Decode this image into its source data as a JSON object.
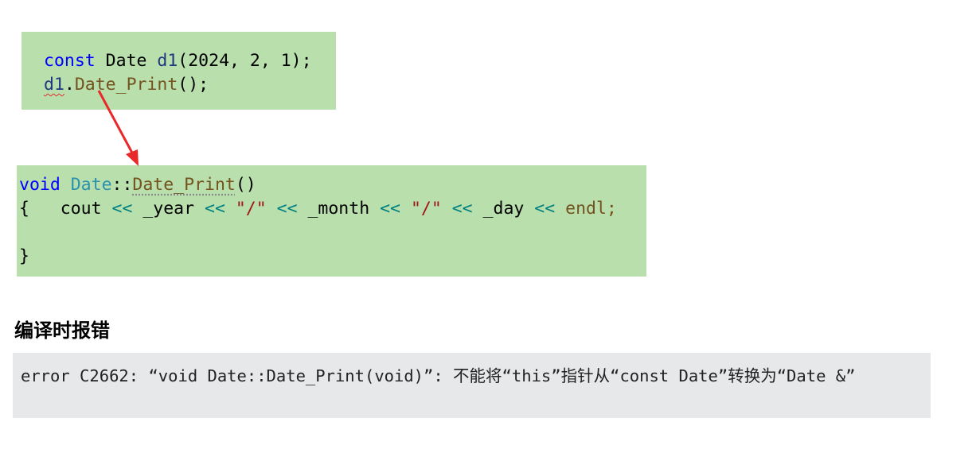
{
  "snippet1": {
    "line1": {
      "kw": "const",
      "type": " Date ",
      "var": "d1",
      "rest": "(2024, 2, 1);"
    },
    "line2": {
      "var": "d1",
      "dot": ".",
      "fn": "Date_Print",
      "rest": "();"
    }
  },
  "snippet2": {
    "sig": {
      "kw": "void",
      "cls": "Date",
      "sep": "::",
      "fn": "Date_Print",
      "rest": "()"
    },
    "open": "{",
    "body": [
      "    cout ",
      "<<",
      " _year ",
      "<<",
      " ",
      "\"/\"",
      " ",
      "<<",
      " _month ",
      "<<",
      " ",
      "\"/\"",
      " ",
      "<<",
      " _day ",
      "<<",
      " endl;"
    ],
    "close": "}"
  },
  "heading": "编译时报错",
  "error": "error C2662: “void Date::Date_Print(void)”: 不能将“this”指针从“const Date”转换为“Date &”",
  "colors": {
    "code_bg": "#b8dfac",
    "error_bg": "#e7e8e9",
    "arrow": "#e8282b"
  }
}
